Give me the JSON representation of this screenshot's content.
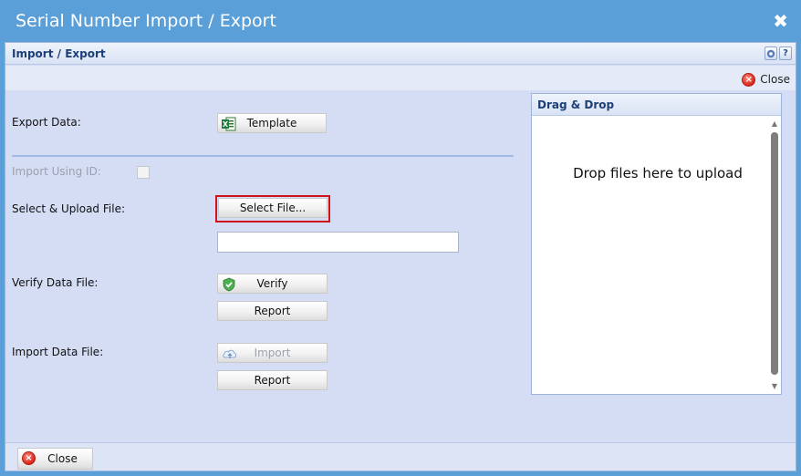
{
  "window": {
    "title": "Serial Number Import / Export",
    "close_glyph": "✖"
  },
  "panel": {
    "title": "Import / Export",
    "header_buttons": {
      "settings_icon": "gear-icon",
      "help_label": "?"
    },
    "close_label": "Close"
  },
  "form": {
    "export_label": "Export Data:",
    "template_label": "Template",
    "import_id_label": "Import Using ID:",
    "import_id_checked": false,
    "select_label": "Select & Upload File:",
    "select_button_label": "Select File...",
    "file_value": "",
    "verify_label": "Verify Data File:",
    "verify_button_label": "Verify",
    "verify_report_label": "Report",
    "import_label": "Import Data File:",
    "import_button_label": "Import",
    "import_report_label": "Report"
  },
  "dragdrop": {
    "title": "Drag & Drop",
    "text": "Drop files here to upload"
  },
  "footer": {
    "close_label": "Close"
  },
  "colors": {
    "titlebar": "#5b9fd8",
    "panel_bg": "#d5ddf5",
    "highlight": "#d0121a",
    "header_text": "#1c3f7a"
  },
  "icons": {
    "template": "excel-icon",
    "verify": "shield-check-icon",
    "import": "cloud-upload-icon",
    "close": "close-icon"
  }
}
